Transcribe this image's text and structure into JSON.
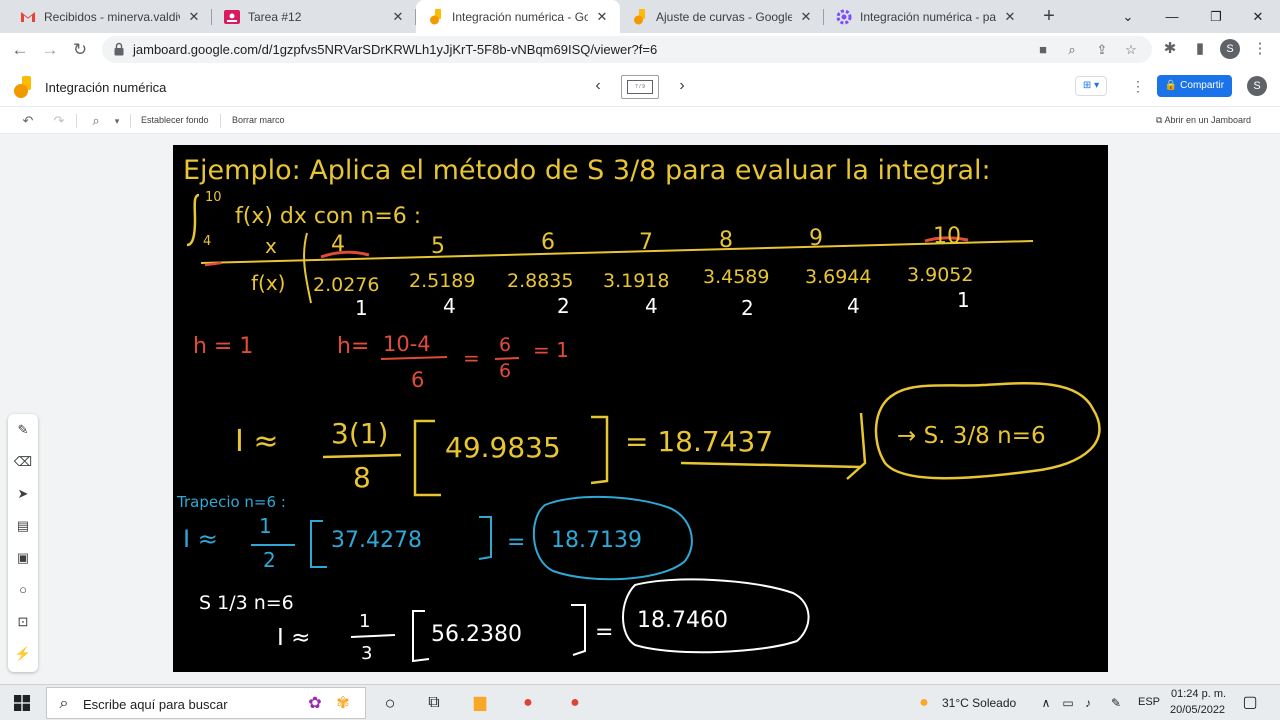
{
  "browser": {
    "tabs": [
      {
        "label": "Recibidos - minerva.valdivia@",
        "icon": "gmail-icon",
        "color": "#ea4335",
        "active": false
      },
      {
        "label": "Tarea #12",
        "icon": "classroom-icon",
        "color": "#e91e63",
        "active": false
      },
      {
        "label": "Integración numérica - Goog",
        "icon": "jamboard-icon",
        "color": "#fbbc04",
        "active": true
      },
      {
        "label": "Ajuste de curvas - Google Ja",
        "icon": "jamboard-icon",
        "color": "#fbbc04",
        "active": false
      },
      {
        "label": "Integración numérica - parte",
        "icon": "settings-gear-icon",
        "color": "#7c4dff",
        "active": false
      }
    ],
    "url": "jamboard.google.com/d/1gzpfvs5NRVarSDrKRWLh1yJjKrT-5F8b-vNBqm69ISQ/viewer?f=6",
    "profile_initial": "S"
  },
  "jamboard": {
    "title": "Integración numérica",
    "frame_indicator": "7 / 9",
    "share_label": "Compartir",
    "avatar": "S",
    "toolbar": {
      "set_background": "Establecer fondo",
      "clear_frame": "Borrar marco",
      "open_in_jamboard": "Abrir en un Jamboard"
    }
  },
  "board": {
    "heading": "Ejemplo: Aplica el método de S 3/8 para evaluar la integral:",
    "integral": {
      "upper": "10",
      "lower": "4",
      "expr": "f(x) dx  con n=6 :"
    },
    "table": {
      "x_label": "x",
      "fx_label": "f(x)",
      "x_values": [
        "4",
        "5",
        "6",
        "7",
        "8",
        "9",
        "10"
      ],
      "fx_values": [
        "2.0276",
        "2.5189",
        "2.8835",
        "3.1918",
        "3.4589",
        "3.6944",
        "3.9052"
      ],
      "weights": [
        "1",
        "4",
        "2",
        "4",
        "2",
        "4",
        "1"
      ]
    },
    "h_label": "h = 1",
    "h_formula": {
      "lhs": "h=",
      "num": "10-4",
      "den": "6",
      "frac_num": "6",
      "frac_den": "6",
      "result": "= 1"
    },
    "s38": {
      "lhs": "I ≈",
      "num": "3(1)",
      "den": "8",
      "bracket": "49.9835",
      "result": "= 18.7437",
      "cloud": "→ S. 3/8 n=6"
    },
    "trapecio": {
      "title": "Trapecio n=6 :",
      "lhs": "I ≈",
      "num": "1",
      "den": "2",
      "bracket": "37.4278",
      "result": "=",
      "cloud": "18.7139"
    },
    "s13": {
      "title": "S 1/3  n=6",
      "lhs": "I ≈",
      "num": "1",
      "den": "3",
      "bracket": "56.2380",
      "result": "=",
      "cloud": "18.7460"
    }
  },
  "taskbar": {
    "search_placeholder": "Escribe aquí para buscar",
    "weather": "31°C  Soleado",
    "language": "ESP",
    "time": "01:24 p. m.",
    "date": "20/05/2022"
  }
}
